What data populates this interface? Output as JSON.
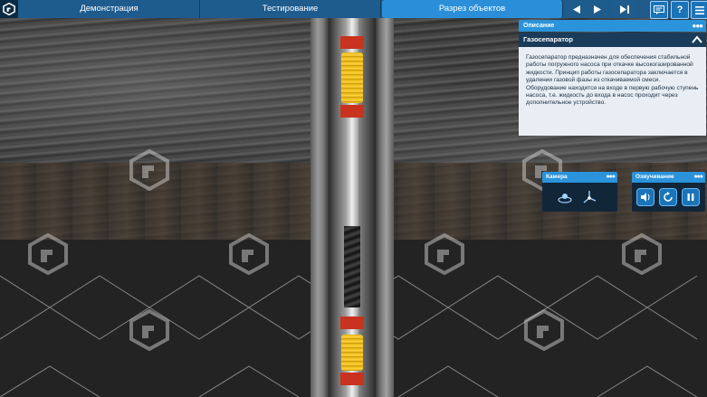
{
  "header": {
    "tabs": [
      {
        "label": "Демонстрация",
        "active": false
      },
      {
        "label": "Тестирование",
        "active": false
      },
      {
        "label": "Разрез объектов",
        "active": true
      }
    ],
    "nav_icons": [
      "prev-icon",
      "next-icon",
      "last-icon"
    ],
    "help_label": "?",
    "accent_color": "#2a8fd8",
    "bar_color": "#1e5a8a"
  },
  "description_panel": {
    "header": "Описание",
    "title": "Газосепаратор",
    "body": "Газосепаратор предназначен для обеспечения стабильной работы погружного насоса при откачке высокогазированной жидкости. Принцип работы газосепаратора заключается в удалении газовой фазы из откачиваемой смеси. Оборудование находится на входе в первую рабочую ступень насоса, т.е. жидкость до входа в насос проходит через дополнительное устройство."
  },
  "camera_panel": {
    "header": "Камера",
    "icons": [
      "orbit-camera-icon",
      "axis-camera-icon"
    ]
  },
  "voice_panel": {
    "header": "Озвучивание",
    "icons": [
      "sound-icon",
      "replay-icon",
      "pause-icon"
    ]
  }
}
